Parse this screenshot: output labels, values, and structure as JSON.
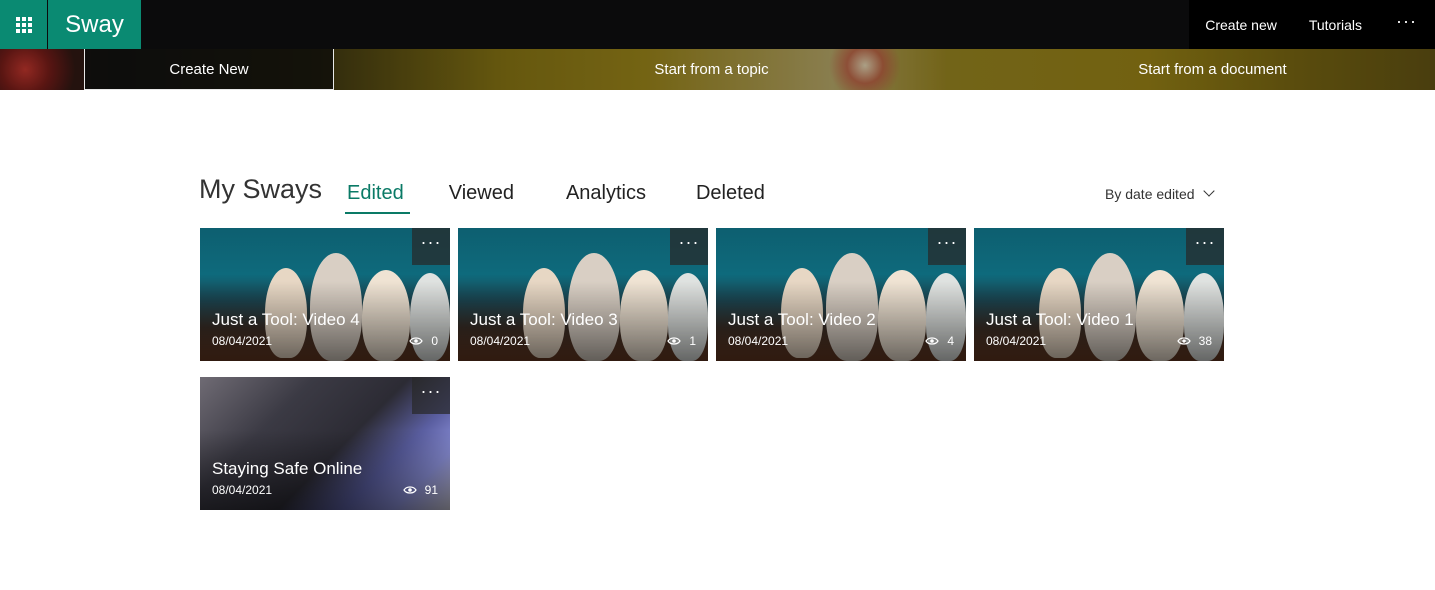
{
  "app": {
    "name": "Sway"
  },
  "topnav": {
    "create_new": "Create new",
    "tutorials": "Tutorials",
    "more": "···"
  },
  "banner": {
    "create_new": "Create New",
    "start_topic": "Start from a topic",
    "start_document": "Start from a document"
  },
  "section": {
    "title": "My Sways",
    "tabs": [
      {
        "label": "Edited",
        "active": true
      },
      {
        "label": "Viewed",
        "active": false
      },
      {
        "label": "Analytics",
        "active": false
      },
      {
        "label": "Deleted",
        "active": false
      }
    ],
    "sort_label": "By date edited"
  },
  "cards": [
    {
      "title": "Just a Tool: Video 4",
      "date": "08/04/2021",
      "views": "0",
      "image": "family-photo"
    },
    {
      "title": "Just a Tool: Video 3",
      "date": "08/04/2021",
      "views": "1",
      "image": "family-photo"
    },
    {
      "title": "Just a Tool: Video 2",
      "date": "08/04/2021",
      "views": "4",
      "image": "family-photo"
    },
    {
      "title": "Just a Tool: Video 1",
      "date": "08/04/2021",
      "views": "38",
      "image": "family-photo"
    },
    {
      "title": "Staying Safe Online",
      "date": "08/04/2021",
      "views": "91",
      "image": "laptop-photo"
    }
  ],
  "card_menu": "···",
  "colors": {
    "brand": "#0a8a72",
    "accent": "#0a7a66",
    "topbar": "#0b0b0c"
  }
}
